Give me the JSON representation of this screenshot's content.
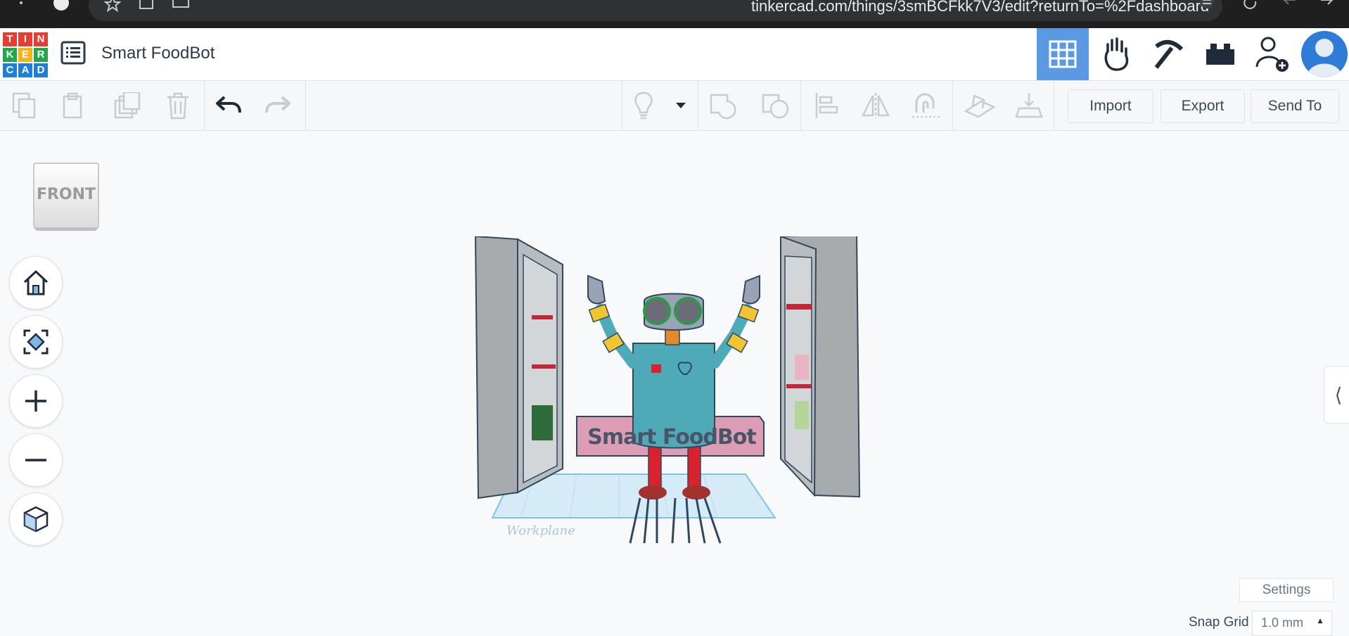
{
  "browser": {
    "url": "tinkercad.com/things/3smBCFkk7V3/edit?returnTo=%2Fdashboard"
  },
  "app": {
    "logo_letters": [
      "T",
      "I",
      "N",
      "K",
      "E",
      "R",
      "C",
      "A",
      "D"
    ],
    "logo_colors": [
      "#e53d2f",
      "#e53d2f",
      "#e53d2f",
      "#24a74a",
      "#f5b31a",
      "#24a74a",
      "#1f7fd6",
      "#1f7fd6",
      "#1f7fd6"
    ],
    "title": "Smart FoodBot",
    "accent": "#5c99e3"
  },
  "toolbar": {
    "import_label": "Import",
    "export_label": "Export",
    "send_to_label": "Send To"
  },
  "viewport": {
    "viewcube_label": "FRONT",
    "workplane_label": "Workplane",
    "nameplate_text": "Smart FoodBot",
    "settings_label": "Settings",
    "snap_grid_label": "Snap Grid",
    "snap_grid_value": "1.0 mm"
  }
}
